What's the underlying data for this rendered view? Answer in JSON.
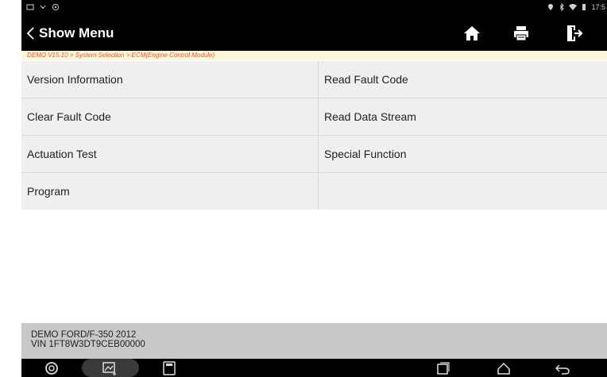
{
  "header": {
    "title": "Show Menu"
  },
  "breadcrumb": "DEMO V15.10 > System Selection > ECM(Engine Control Module)",
  "menu": {
    "items": [
      {
        "label": "Version Information"
      },
      {
        "label": "Read Fault Code"
      },
      {
        "label": "Clear Fault Code"
      },
      {
        "label": "Read Data Stream"
      },
      {
        "label": "Actuation Test"
      },
      {
        "label": "Special Function"
      },
      {
        "label": "Program"
      },
      {
        "label": ""
      }
    ]
  },
  "vehicle": {
    "model": "DEMO FORD/F-350 2012",
    "vin": "VIN 1FT8W3DT9CEB00000"
  },
  "statusbar": {
    "time": "17:5"
  },
  "navbar": {
    "vci_label": "VCI"
  },
  "icons": {
    "home": "home-icon",
    "print": "print-icon",
    "exit": "exit-icon",
    "back": "chevron-left-icon"
  },
  "colors": {
    "header_bg": "#000000",
    "breadcrumb_bg": "#fff6d9",
    "breadcrumb_text": "#ee5533",
    "cell_bg": "#efefef",
    "vehicle_bg": "#c8c8c8"
  }
}
